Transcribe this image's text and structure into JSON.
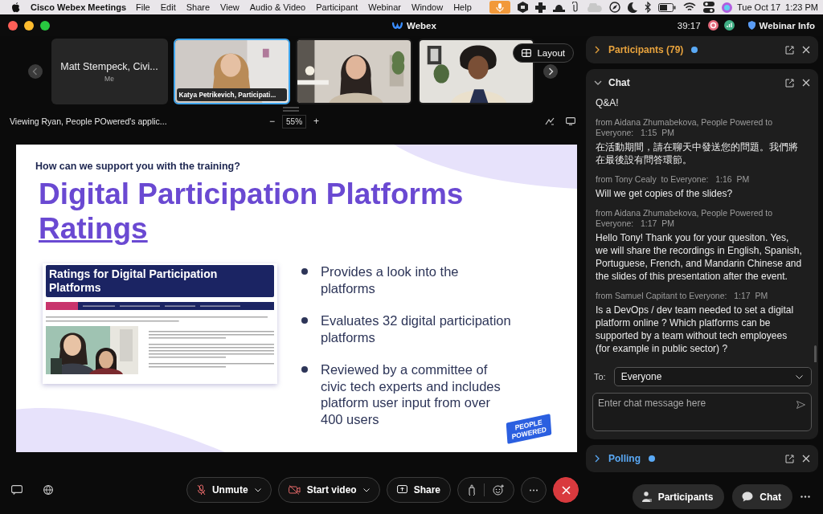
{
  "menu_bar": {
    "app": "Cisco Webex Meetings",
    "items": [
      "File",
      "Edit",
      "Share",
      "View",
      "Audio & Video",
      "Participant",
      "Webinar",
      "Window",
      "Help"
    ],
    "date": "Tue Oct 17",
    "time": "1:23 PM"
  },
  "title_bar": {
    "title": "Webex",
    "timer": "39:17",
    "info": "Webinar Info"
  },
  "video_strip": {
    "layout": "Layout",
    "tiles": [
      {
        "kind": "name",
        "name": "Matt Stempeck, Civi...",
        "sub": "Me",
        "selected": false
      },
      {
        "kind": "video",
        "name": "Katya Petrikevich, Participati...",
        "selected": true
      },
      {
        "kind": "video",
        "selected": false
      },
      {
        "kind": "video",
        "selected": false
      }
    ]
  },
  "share_bar": {
    "viewing": "Viewing Ryan, People POwered's applic...",
    "zoom_out": "−",
    "zoom": "55%",
    "zoom_in": "+"
  },
  "slide": {
    "kicker": "How can we support you with the training?",
    "title": "Digital Participation Platforms",
    "title_link": "Ratings",
    "embedded": {
      "heading": "Ratings for Digital Participation Platforms"
    },
    "bullets": [
      "Provides a look into the platforms",
      "Evaluates 32 digital participation platforms",
      "Reviewed by a committee of civic tech experts and includes platform user input from over 400 users"
    ],
    "logo": "PEOPLE POWERED"
  },
  "toolbar": {
    "buttons": [
      "Unmute",
      "Start video",
      "Share"
    ]
  },
  "panels": {
    "participants": {
      "title": "Participants (79)",
      "color": "#e8a33d",
      "expanded": false,
      "unread": true
    },
    "chat": {
      "title": "Chat",
      "expanded": true,
      "messages": [
        {
          "text": "Q&A!"
        },
        {
          "meta": "from Aidana Zhumabekova, People Powered to Everyone:   1:15  PM",
          "text": "在活動期間，請在聊天中發送您的問題。我們將在最後設有問答環節。"
        },
        {
          "meta": "from Tony Cealy  to Everyone:   1:16  PM",
          "text": "Will we get copies of the slides?"
        },
        {
          "meta": "from Aidana Zhumabekova, People Powered to Everyone:   1:17  PM",
          "text": "Hello Tony! Thank you for your quesiton. Yes, we will share the recordings in English, Spanish, Portuguese, French, and Mandarin Chinese and the slides of this presentation after the event."
        },
        {
          "meta": "from Samuel Capitant to Everyone:   1:17  PM",
          "text": "Is a DevOps / dev team needed to set a digital platform online ? Which platforms can be supported by a team without tech employees (for example in public sector) ?"
        }
      ],
      "to_label": "To:",
      "recipient": "Everyone",
      "placeholder": "Enter chat message here"
    },
    "polling": {
      "title": "Polling",
      "color": "#5aa9f5",
      "expanded": false,
      "unread": true
    }
  },
  "side_buttons": [
    "Participants",
    "Chat"
  ]
}
